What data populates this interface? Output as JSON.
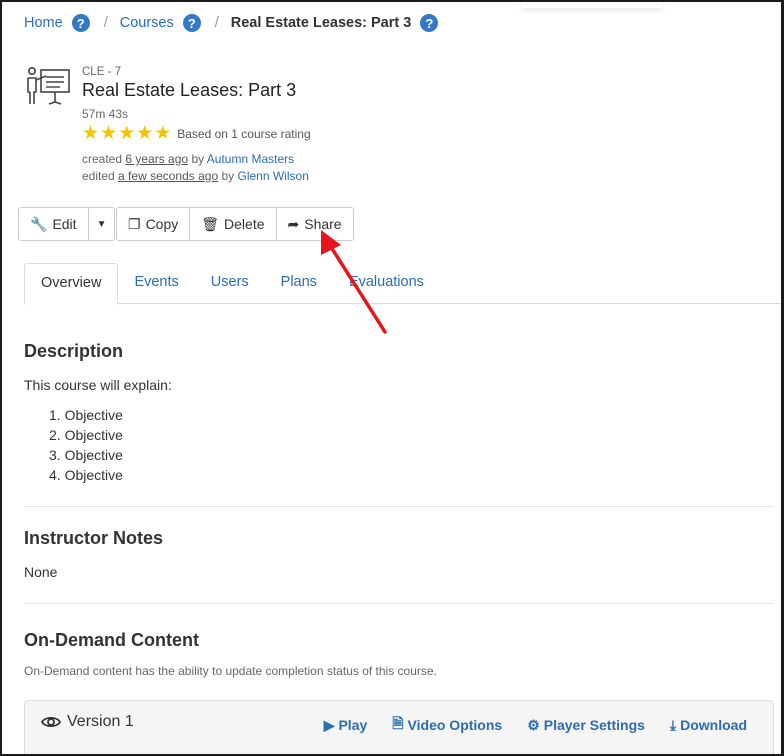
{
  "breadcrumb": {
    "home": "Home",
    "courses": "Courses",
    "current": "Real Estate Leases: Part 3",
    "help_glyph": "?"
  },
  "course": {
    "code": "CLE - 7",
    "title": "Real Estate Leases: Part 3",
    "duration": "57m 43s",
    "rating": {
      "stars": 5,
      "max": 5,
      "text": "Based on 1 course rating"
    },
    "created_prefix": "created",
    "created_when": "6 years ago",
    "created_by_word": "by",
    "created_by": "Autumn Masters",
    "edited_prefix": "edited",
    "edited_when": "a few seconds ago",
    "edited_by_word": "by",
    "edited_by": "Glenn Wilson"
  },
  "toolbar": {
    "edit": "Edit",
    "copy": "Copy",
    "delete": "Delete",
    "share": "Share"
  },
  "tabs": [
    {
      "label": "Overview",
      "active": true
    },
    {
      "label": "Events"
    },
    {
      "label": "Users"
    },
    {
      "label": "Plans"
    },
    {
      "label": "Evaluations"
    }
  ],
  "description": {
    "heading": "Description",
    "intro": "This course will explain:",
    "items": [
      "1. Objective",
      "2. Objective",
      "3. Objective",
      "4. Objective"
    ]
  },
  "instructor_notes": {
    "heading": "Instructor Notes",
    "text": "None"
  },
  "on_demand": {
    "heading": "On-Demand Content",
    "note": "On-Demand content has the ability to update completion status of this course.",
    "version_label": "Version 1",
    "actions": {
      "play": "Play",
      "video_options": "Video Options",
      "player_settings": "Player Settings",
      "download": "Download"
    }
  },
  "colors": {
    "link": "#2a6db0",
    "help_badge": "#3478c6",
    "star": "#f5c400",
    "annotation_arrow": "#e8141c"
  }
}
